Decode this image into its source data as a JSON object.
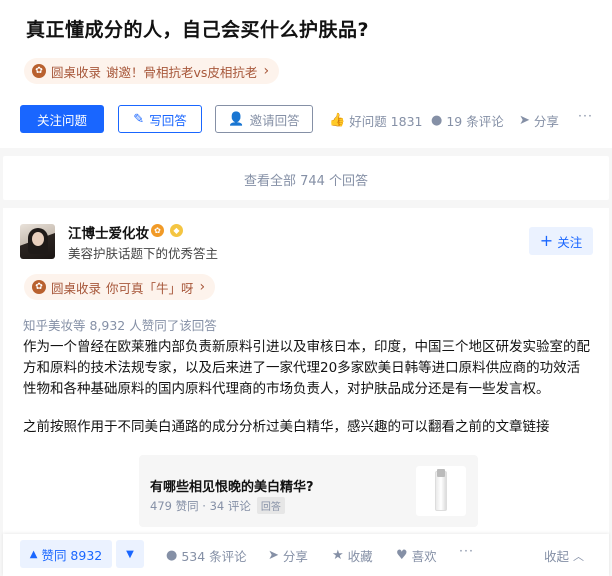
{
  "question": {
    "title": "真正懂成分的人，自己会买什么护肤品?",
    "roundtable_pill": {
      "label": "圆桌收录",
      "text": "谢邀！骨相抗老vs皮相抗老"
    },
    "actions": {
      "follow": "关注问题",
      "write": "写回答",
      "invite": "邀请回答",
      "good_question": "好问题 1831",
      "comments": "19 条评论",
      "share": "分享",
      "more": "···"
    }
  },
  "view_all": "查看全部 744 个回答",
  "answer": {
    "author": {
      "name": "江博士爱化妆",
      "description": "美容护肤话题下的优秀答主",
      "follow_label": "关注"
    },
    "roundtable_pill": {
      "label": "圆桌收录",
      "text": "你可真「牛」呀"
    },
    "upvote_info": "知乎美妆等 8,932 人赞同了该回答",
    "paragraphs": [
      "作为一个曾经在欧莱雅内部负责新原料引进以及审核日本，印度，中国三个地区研发实验室的配方和原料的技术法规专家，以及后来进了一家代理20多家欧美日韩等进口原料供应商的功效活性物和各种基础原料的国内原料代理商的市场负责人，对护肤品成分还是有一些发言权。",
      "之前按照作用于不同美白通路的成分分析过美白精华，感兴趣的可以翻看之前的文章链接"
    ],
    "link_card": {
      "title": "有哪些相见恨晚的美白精华?",
      "meta": "479 赞同 · 34 评论",
      "tag": "回答"
    },
    "actions": {
      "upvote": "赞同 8932",
      "comments": "534 条评论",
      "share": "分享",
      "collect": "收藏",
      "like": "喜欢",
      "more": "···",
      "collapse": "收起"
    }
  },
  "colors": {
    "primary": "#1966ff",
    "primary_light": "#ebf2ff",
    "muted": "#8590a6",
    "roundtable": "#a7573a"
  },
  "icons": {
    "roundtable": "roundtable-icon",
    "pen": "pen-icon",
    "invite": "person-plus-icon",
    "thumb": "thumb-up-icon",
    "comment": "comment-bubble-icon",
    "share": "paper-plane-icon",
    "star": "star-icon",
    "heart": "heart-icon",
    "chevron_up": "chevron-up-icon",
    "chevron_right": "chevron-right-icon"
  }
}
